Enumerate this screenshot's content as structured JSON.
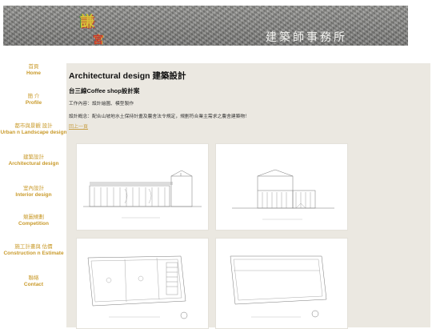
{
  "header": {
    "logo_glyph_1": "謙",
    "logo_glyph_2": "宮",
    "firm_name": "建築師事務所"
  },
  "nav": {
    "items": [
      {
        "zh": "首頁",
        "en": "Home"
      },
      {
        "zh": "簡 介",
        "en": "Profile"
      },
      {
        "zh": "都市與景觀 設計",
        "en": "Urban n Landscape design"
      },
      {
        "zh": "建築設計",
        "en": "Architectural design"
      },
      {
        "zh": "室內設計",
        "en": "Interior design"
      },
      {
        "zh": "競圖規劃",
        "en": "Competition"
      },
      {
        "zh": "施工計畫與 估價",
        "en": "Construction n Estimate"
      },
      {
        "zh": "聯絡",
        "en": "Contact"
      }
    ]
  },
  "main": {
    "page_title": "Architectural design  建築設計",
    "project_title": "台三線Coffee shop設計案",
    "work_content": "工作內容：設計繪圖、模型製作",
    "concept": "設計概念：配合山坡地水土保持計畫及農舍法令規定，規劃符合業主需求之農舍建築物！",
    "back_link": "回上一頁"
  },
  "drawings": [
    {
      "kind": "elevation"
    },
    {
      "kind": "elevation"
    },
    {
      "kind": "plan"
    },
    {
      "kind": "plan"
    }
  ]
}
